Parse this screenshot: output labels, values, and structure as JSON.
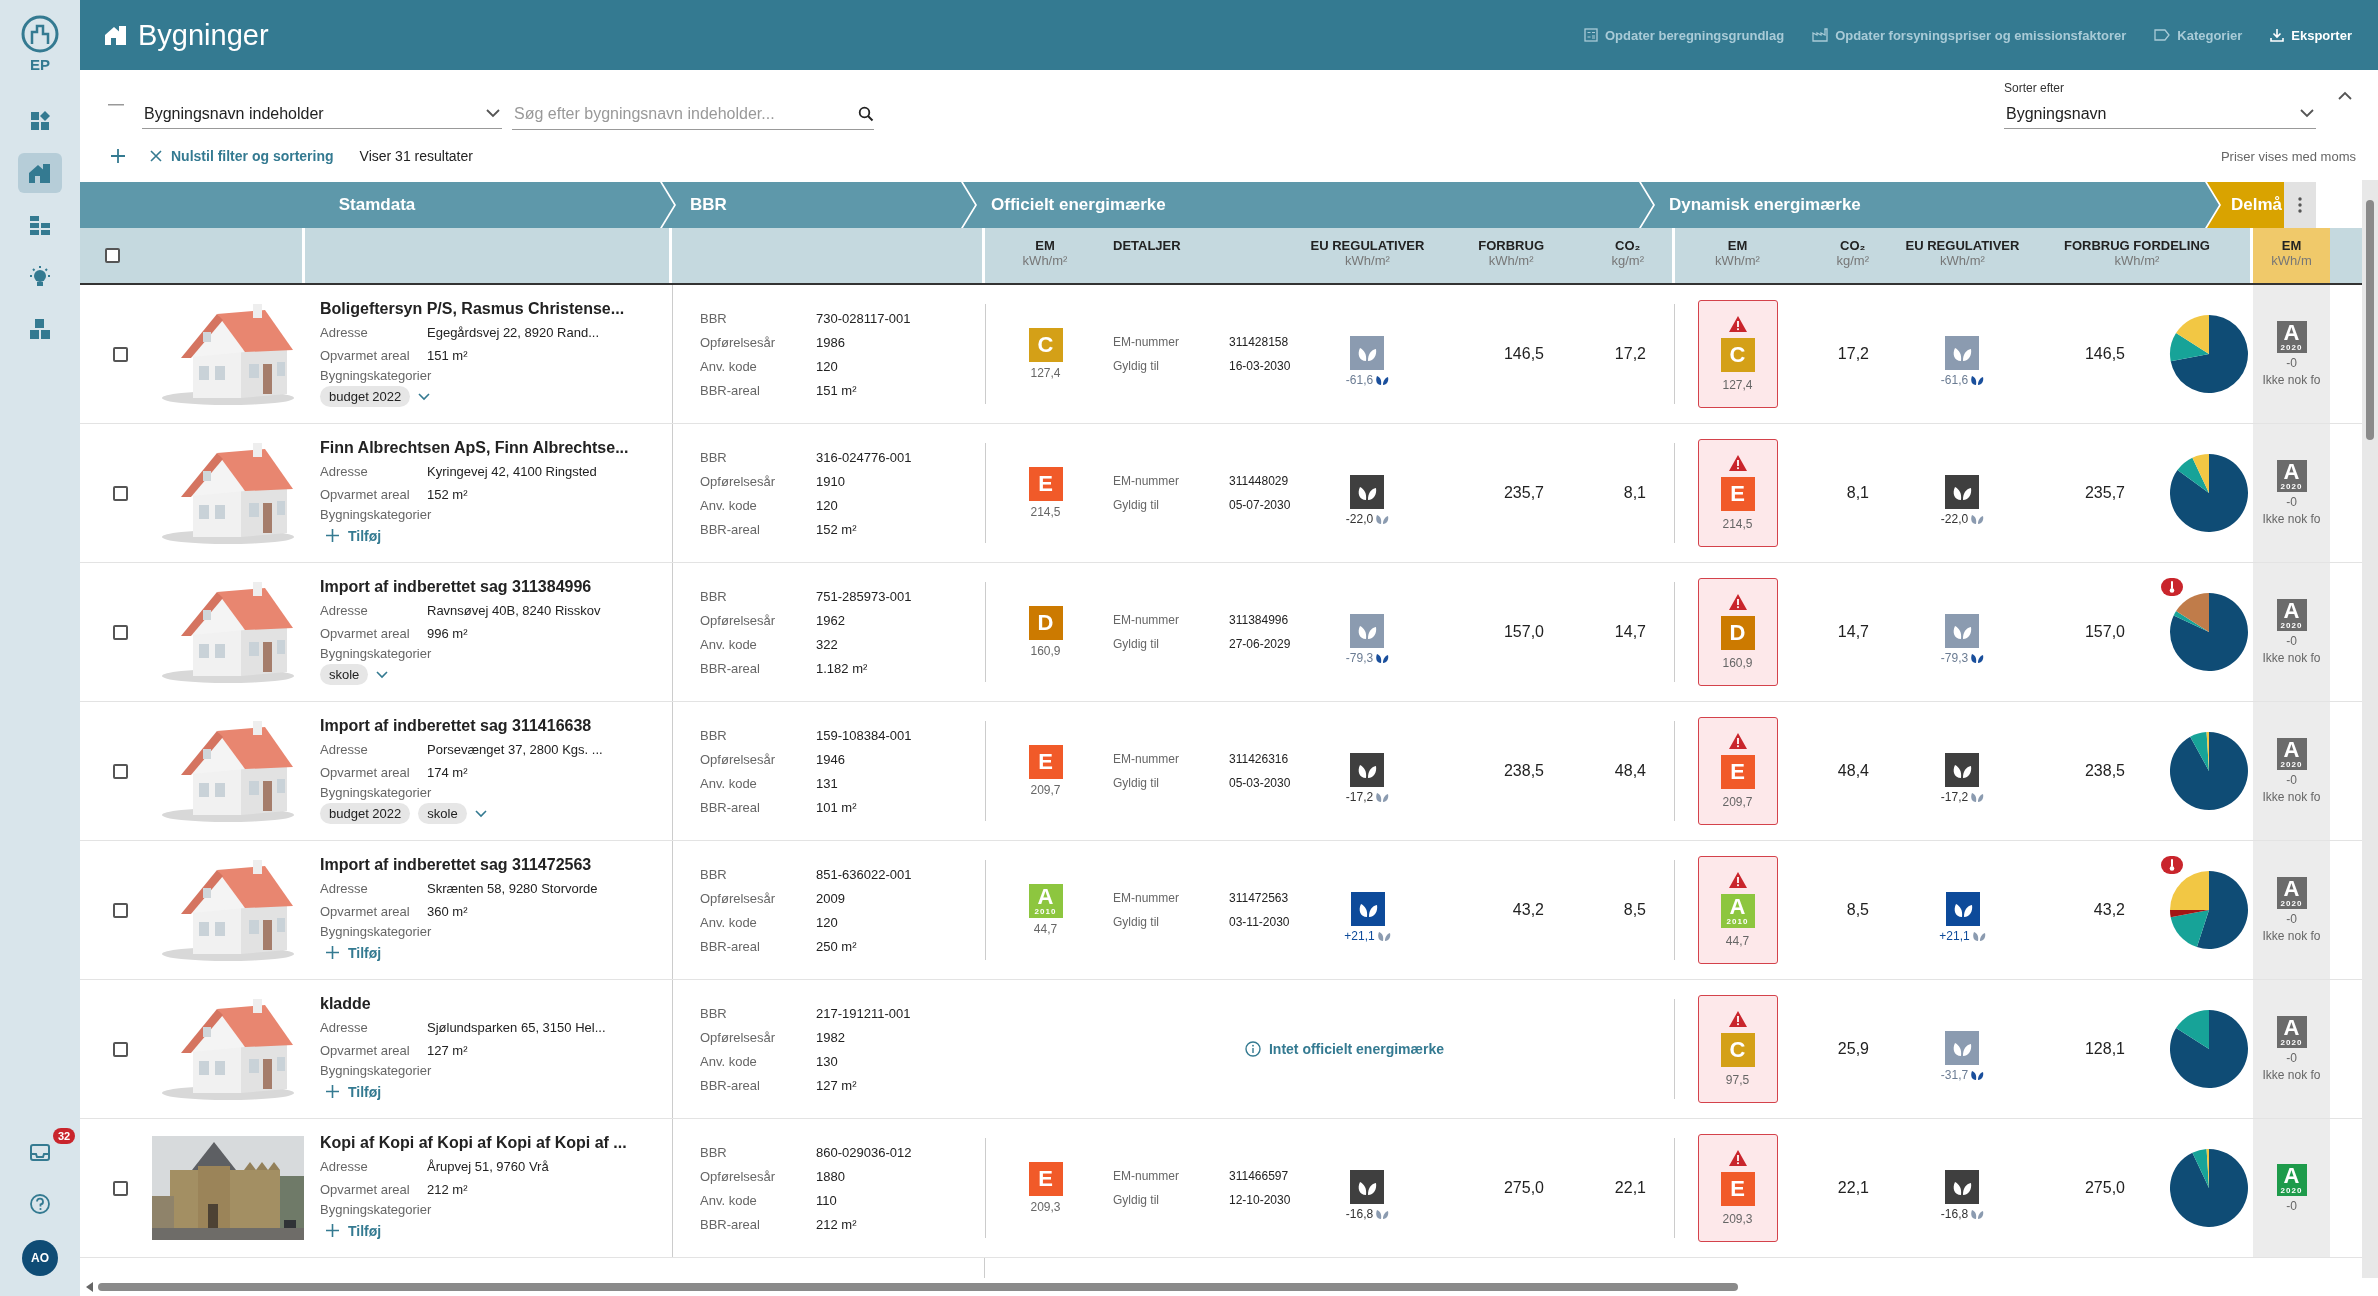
{
  "sidebar": {
    "logo_label": "EP",
    "items": [
      {
        "kind": "dashboard",
        "selected": false
      },
      {
        "kind": "buildings",
        "selected": true
      },
      {
        "kind": "bricks",
        "selected": false
      },
      {
        "kind": "idea",
        "selected": false
      },
      {
        "kind": "blocks",
        "selected": false
      }
    ],
    "inbox_count": "32",
    "avatar": "AO"
  },
  "header": {
    "title": "Bygninger",
    "actions": [
      {
        "kind": "calculator",
        "label": "Opdater beregningsgrundlag",
        "emphasis": false
      },
      {
        "kind": "factory",
        "label": "Opdater forsyningspriser og emissionsfaktorer",
        "emphasis": false
      },
      {
        "kind": "tag",
        "label": "Kategorier",
        "emphasis": false
      },
      {
        "kind": "download",
        "label": "Eksporter",
        "emphasis": true
      }
    ]
  },
  "filters": {
    "field": "Bygningsnavn indeholder",
    "search_placeholder": "Søg efter bygningsnavn indeholder...",
    "reset": "Nulstil filter og sortering",
    "result_count": "Viser 31 resultater",
    "sort_label": "Sorter efter",
    "sort_value": "Bygningsnavn",
    "price_note": "Priser vises med moms"
  },
  "table": {
    "select_all_checked": false,
    "groups": [
      {
        "kind": "stamdata",
        "label": "Stamdata"
      },
      {
        "kind": "bbr",
        "label": "BBR"
      },
      {
        "kind": "official",
        "label": "Officielt energimærke",
        "columns": [
          {
            "label": "EM",
            "unit": "kWh/m²"
          },
          {
            "label": "DETALJER"
          },
          {
            "label": "EU REGULATIVER",
            "unit": "kWh/m²"
          },
          {
            "label": "FORBRUG",
            "unit": "kWh/m²"
          },
          {
            "label": "CO₂",
            "unit": "kg/m²"
          }
        ]
      },
      {
        "kind": "dynamic",
        "label": "Dynamisk energimærke",
        "columns": [
          {
            "label": "EM",
            "unit": "kWh/m²"
          },
          {
            "label": "CO₂",
            "unit": "kg/m²"
          },
          {
            "label": "EU REGULATIVER",
            "unit": "kWh/m²"
          },
          {
            "label": "FORBRUG FORDELING",
            "unit": "kWh/m²"
          }
        ]
      },
      {
        "kind": "target",
        "label": "Delmå",
        "columns": [
          {
            "label": "EM",
            "unit": "kWh/m"
          }
        ]
      }
    ],
    "rows": [
      {
        "checked": false,
        "title": "Boligeftersyn P/S, Rasmus Christense...",
        "info": [
          {
            "label": "Adresse",
            "value": "Egegårdsvej 22, 8920 Rand..."
          },
          {
            "label": "Opvarmet areal",
            "value": "151 m²"
          }
        ],
        "categories_label": "Bygningskategorier",
        "tags": [
          "budget 2022"
        ],
        "bbr": [
          {
            "label": "BBR",
            "value": "730-028117-001"
          },
          {
            "label": "Opførelsesår",
            "value": "1986"
          },
          {
            "label": "Anv. kode",
            "value": "120"
          },
          {
            "label": "BBR-areal",
            "value": "151 m²"
          }
        ],
        "official": {
          "em": {
            "letter": "C",
            "color": "#d4a017",
            "value": "127,4"
          },
          "details": [
            {
              "label": "EM-nummer",
              "value": "311428158"
            },
            {
              "label": "Gyldig til",
              "value": "16-03-2030"
            }
          ],
          "eu": {
            "kind": "neutral",
            "value": "-61,6"
          },
          "forbrug": "146,5",
          "co2": "17,2"
        },
        "dynamic": {
          "em": {
            "letter": "C",
            "color": "#d4a017",
            "value": "127,4"
          },
          "co2": "17,2",
          "eu": {
            "kind": "neutral",
            "value": "-61,6"
          },
          "forbrug": "146,5",
          "alert": false
        },
        "target": {
          "em": {
            "letter": "A",
            "year": "2020",
            "color": "#6b6b6b",
            "value": "-0"
          },
          "note": "Ikke nok fo"
        }
      },
      {
        "checked": false,
        "title": "Finn Albrechtsen ApS, Finn Albrechtse...",
        "info": [
          {
            "label": "Adresse",
            "value": "Kyringevej 42, 4100 Ringsted"
          },
          {
            "label": "Opvarmet areal",
            "value": "152 m²"
          }
        ],
        "categories_label": "Bygningskategorier",
        "add_label": "Tilføj",
        "bbr": [
          {
            "label": "BBR",
            "value": "316-024776-001"
          },
          {
            "label": "Opførelsesår",
            "value": "1910"
          },
          {
            "label": "Anv. kode",
            "value": "120"
          },
          {
            "label": "BBR-areal",
            "value": "152 m²"
          }
        ],
        "official": {
          "em": {
            "letter": "E",
            "color": "#f15a29",
            "value": "214,5"
          },
          "details": [
            {
              "label": "EM-nummer",
              "value": "311448029"
            },
            {
              "label": "Gyldig til",
              "value": "05-07-2030"
            }
          ],
          "eu": {
            "kind": "fail",
            "value": "-22,0"
          },
          "forbrug": "235,7",
          "co2": "8,1"
        },
        "dynamic": {
          "em": {
            "letter": "E",
            "color": "#f15a29",
            "value": "214,5"
          },
          "co2": "8,1",
          "eu": {
            "kind": "fail",
            "value": "-22,0"
          },
          "forbrug": "235,7",
          "alert": false
        },
        "target": {
          "em": {
            "letter": "A",
            "year": "2020",
            "color": "#6b6b6b",
            "value": "-0"
          },
          "note": "Ikke nok fo"
        }
      },
      {
        "checked": false,
        "title": "Import af indberettet sag 311384996",
        "info": [
          {
            "label": "Adresse",
            "value": "Ravnsøvej 40B, 8240 Risskov"
          },
          {
            "label": "Opvarmet areal",
            "value": "996 m²"
          }
        ],
        "categories_label": "Bygningskategorier",
        "tags": [
          "skole"
        ],
        "bbr": [
          {
            "label": "BBR",
            "value": "751-285973-001"
          },
          {
            "label": "Opførelsesår",
            "value": "1962"
          },
          {
            "label": "Anv. kode",
            "value": "322"
          },
          {
            "label": "BBR-areal",
            "value": "1.182 m²"
          }
        ],
        "official": {
          "em": {
            "letter": "D",
            "color": "#cc7a00",
            "value": "160,9"
          },
          "details": [
            {
              "label": "EM-nummer",
              "value": "311384996"
            },
            {
              "label": "Gyldig til",
              "value": "27-06-2029"
            }
          ],
          "eu": {
            "kind": "neutral",
            "value": "-79,3"
          },
          "forbrug": "157,0",
          "co2": "14,7"
        },
        "dynamic": {
          "em": {
            "letter": "D",
            "color": "#cc7a00",
            "value": "160,9"
          },
          "co2": "14,7",
          "eu": {
            "kind": "neutral",
            "value": "-79,3"
          },
          "forbrug": "157,0",
          "alert": true
        },
        "target": {
          "em": {
            "letter": "A",
            "year": "2020",
            "color": "#6b6b6b",
            "value": "-0"
          },
          "note": "Ikke nok fo"
        }
      },
      {
        "checked": false,
        "title": "Import af indberettet sag 311416638",
        "info": [
          {
            "label": "Adresse",
            "value": "Porsevænget 37, 2800 Kgs. ..."
          },
          {
            "label": "Opvarmet areal",
            "value": "174 m²"
          }
        ],
        "categories_label": "Bygningskategorier",
        "tags": [
          "budget 2022",
          "skole"
        ],
        "bbr": [
          {
            "label": "BBR",
            "value": "159-108384-001"
          },
          {
            "label": "Opførelsesår",
            "value": "1946"
          },
          {
            "label": "Anv. kode",
            "value": "131"
          },
          {
            "label": "BBR-areal",
            "value": "101 m²"
          }
        ],
        "official": {
          "em": {
            "letter": "E",
            "color": "#f15a29",
            "value": "209,7"
          },
          "details": [
            {
              "label": "EM-nummer",
              "value": "311426316"
            },
            {
              "label": "Gyldig til",
              "value": "05-03-2030"
            }
          ],
          "eu": {
            "kind": "fail",
            "value": "-17,2"
          },
          "forbrug": "238,5",
          "co2": "48,4"
        },
        "dynamic": {
          "em": {
            "letter": "E",
            "color": "#f15a29",
            "value": "209,7"
          },
          "co2": "48,4",
          "eu": {
            "kind": "fail",
            "value": "-17,2"
          },
          "forbrug": "238,5",
          "alert": false
        },
        "target": {
          "em": {
            "letter": "A",
            "year": "2020",
            "color": "#6b6b6b",
            "value": "-0"
          },
          "note": "Ikke nok fo"
        }
      },
      {
        "checked": false,
        "title": "Import af indberettet sag 311472563",
        "info": [
          {
            "label": "Adresse",
            "value": "Skrænten 58, 9280 Storvorde"
          },
          {
            "label": "Opvarmet areal",
            "value": "360 m²"
          }
        ],
        "categories_label": "Bygningskategorier",
        "add_label": "Tilføj",
        "bbr": [
          {
            "label": "BBR",
            "value": "851-636022-001"
          },
          {
            "label": "Opførelsesår",
            "value": "2009"
          },
          {
            "label": "Anv. kode",
            "value": "120"
          },
          {
            "label": "BBR-areal",
            "value": "250 m²"
          }
        ],
        "official": {
          "em": {
            "letter": "A",
            "year": "2010",
            "color": "#8dc63f",
            "value": "44,7"
          },
          "details": [
            {
              "label": "EM-nummer",
              "value": "311472563"
            },
            {
              "label": "Gyldig til",
              "value": "03-11-2030"
            }
          ],
          "eu": {
            "kind": "positive",
            "value": "+21,1"
          },
          "forbrug": "43,2",
          "co2": "8,5"
        },
        "dynamic": {
          "em": {
            "letter": "A",
            "year": "2010",
            "color": "#8dc63f",
            "value": "44,7"
          },
          "co2": "8,5",
          "eu": {
            "kind": "positive",
            "value": "+21,1"
          },
          "forbrug": "43,2",
          "alert": true
        },
        "target": {
          "em": {
            "letter": "A",
            "year": "2020",
            "color": "#6b6b6b",
            "value": "-0"
          },
          "note": "Ikke nok fo"
        }
      },
      {
        "checked": false,
        "title": "kladde",
        "info": [
          {
            "label": "Adresse",
            "value": "Sjølundsparken 65, 3150 Hel..."
          },
          {
            "label": "Opvarmet areal",
            "value": "127 m²"
          }
        ],
        "categories_label": "Bygningskategorier",
        "add_label": "Tilføj",
        "bbr": [
          {
            "label": "BBR",
            "value": "217-191211-001"
          },
          {
            "label": "Opførelsesår",
            "value": "1982"
          },
          {
            "label": "Anv. kode",
            "value": "130"
          },
          {
            "label": "BBR-areal",
            "value": "127 m²"
          }
        ],
        "official_info": "Intet officielt energimærke",
        "dynamic": {
          "em": {
            "letter": "C",
            "color": "#d4a017",
            "value": "97,5"
          },
          "co2": "25,9",
          "eu": {
            "kind": "neutral",
            "value": "-31,7"
          },
          "forbrug": "128,1",
          "alert": false
        },
        "target": {
          "em": {
            "letter": "A",
            "year": "2020",
            "color": "#6b6b6b",
            "value": "-0"
          },
          "note": "Ikke nok fo"
        }
      },
      {
        "checked": false,
        "title": "Kopi af Kopi af Kopi af Kopi af Kopi af ...",
        "info": [
          {
            "label": "Adresse",
            "value": "Årupvej 51, 9760 Vrå"
          },
          {
            "label": "Opvarmet areal",
            "value": "212 m²"
          }
        ],
        "categories_label": "Bygningskategorier",
        "add_label": "Tilføj",
        "bbr": [
          {
            "label": "BBR",
            "value": "860-029036-012"
          },
          {
            "label": "Opførelsesår",
            "value": "1880"
          },
          {
            "label": "Anv. kode",
            "value": "110"
          },
          {
            "label": "BBR-areal",
            "value": "212 m²"
          }
        ],
        "official": {
          "em": {
            "letter": "E",
            "color": "#f15a29",
            "value": "209,3"
          },
          "details": [
            {
              "label": "EM-nummer",
              "value": "311466597"
            },
            {
              "label": "Gyldig til",
              "value": "12-10-2030"
            }
          ],
          "eu": {
            "kind": "fail",
            "value": "-16,8"
          },
          "forbrug": "275,0",
          "co2": "22,1"
        },
        "dynamic": {
          "em": {
            "letter": "E",
            "color": "#f15a29",
            "value": "209,3"
          },
          "co2": "22,1",
          "eu": {
            "kind": "fail",
            "value": "-16,8"
          },
          "forbrug": "275,0",
          "alert": false
        },
        "target": {
          "em": {
            "letter": "A",
            "year": "2020",
            "color": "#1e9b4b",
            "value": "-0"
          }
        }
      }
    ]
  }
}
